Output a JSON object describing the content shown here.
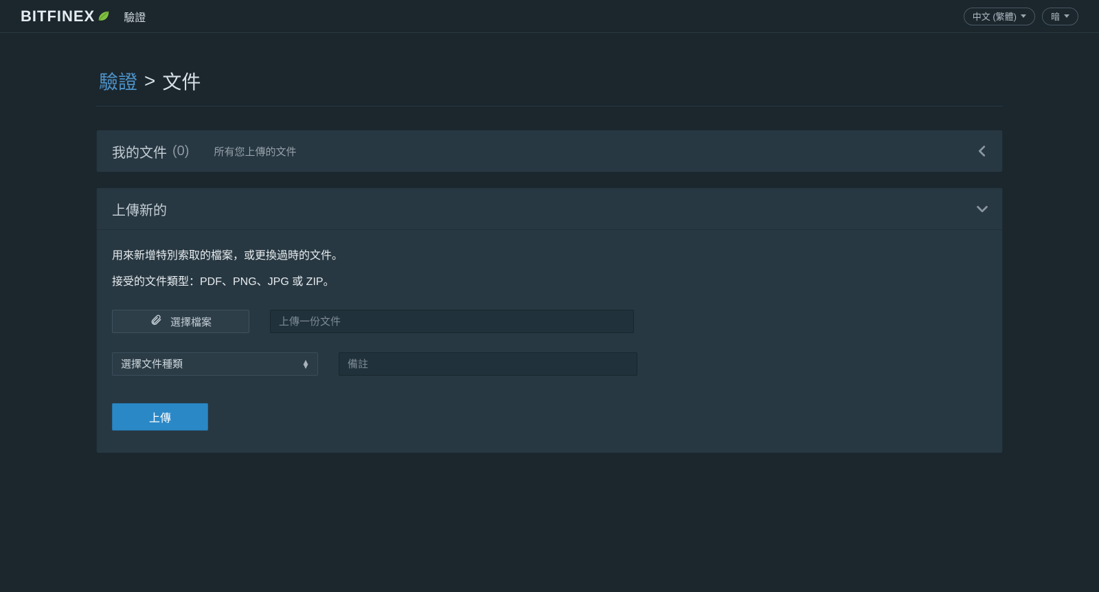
{
  "header": {
    "brand": "BITFINEX",
    "app_label": "驗證",
    "lang_label": "中文 (繁體)",
    "theme_label": "暗"
  },
  "breadcrumb": {
    "root": "驗證",
    "separator": ">",
    "current": "文件"
  },
  "panel_files": {
    "title": "我的文件",
    "count_display": "(0)",
    "subtitle": "所有您上傳的文件"
  },
  "panel_upload": {
    "title": "上傳新的",
    "desc1": "用來新增特別索取的檔案，或更換過時的文件。",
    "desc2": "接受的文件類型：PDF、PNG、JPG 或 ZIP。",
    "choose_file_label": "選擇檔案",
    "file_display_placeholder": "上傳一份文件",
    "select_placeholder": "選擇文件種類",
    "note_placeholder": "備註",
    "upload_button": "上傳"
  }
}
